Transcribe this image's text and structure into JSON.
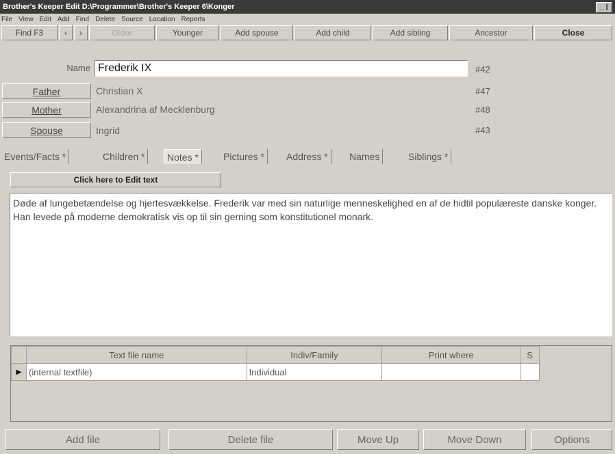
{
  "window": {
    "title": "Brother's Keeper Edit    D:\\Programmer\\Brother's Keeper 6\\Konger",
    "system_button": "_ |"
  },
  "menu": [
    "File",
    "View",
    "Edit",
    "Add",
    "Find",
    "Delete",
    "Source",
    "Location",
    "Reports"
  ],
  "toolbar": {
    "find_label": "Find  F3",
    "prev_label": "‹",
    "next_label": "›",
    "older_label": "Older",
    "younger_label": "Younger",
    "add_spouse_label": "Add spouse",
    "add_child_label": "Add child",
    "add_sibling_label": "Add sibling",
    "ancestor_label": "Ancestor",
    "close_label": "Close"
  },
  "person": {
    "name_label": "Name",
    "name_value": "Frederik IX",
    "name_id": "#42",
    "father_label": "Father",
    "father_value": "Christian X",
    "father_id": "#47",
    "mother_label": "Mother",
    "mother_value": "Alexandrina af Mecklenburg",
    "mother_id": "#48",
    "spouse_label": "Spouse",
    "spouse_value": "Ingrid",
    "spouse_id": "#43"
  },
  "tabs": [
    "Events/Facts *",
    "Children *",
    "Notes *",
    "Pictures *",
    "Address *",
    "Names",
    "Siblings *"
  ],
  "active_tab": "Notes *",
  "notes": {
    "edit_button": "Click here to Edit text",
    "text": "Døde af lungebetændelse og hjertesvækkelse. Frederik var med sin naturlige menneskelighed en af de hidtil populæreste danske konger. Han levede på moderne demokratisk vis op til sin gerning som konstitutionel monark."
  },
  "file_table": {
    "columns": [
      "Text file name",
      "Indiv/Family",
      "Print where",
      "S"
    ],
    "rows": [
      {
        "text_file_name": "(internal textfile)",
        "indiv_family": "Individual",
        "print_where": "",
        "s": ""
      }
    ]
  },
  "bottom_buttons": {
    "add_file": "Add file",
    "delete_file": "Delete file",
    "move_up": "Move Up",
    "move_down": "Move Down",
    "options": "Options"
  }
}
